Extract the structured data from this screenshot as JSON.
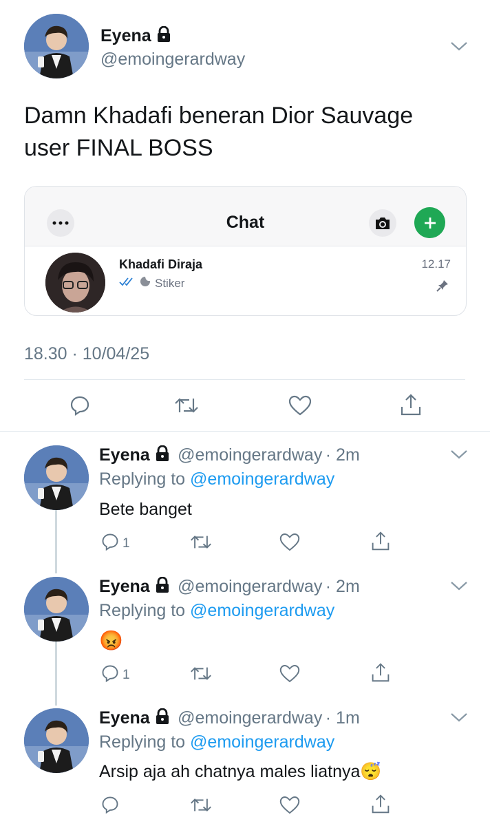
{
  "tweet": {
    "name": "Eyena",
    "handle": "@emoingerardway",
    "text": "Damn Khadafi beneran Dior Sauvage user FINAL BOSS",
    "timestamp": "18.30 · 10/04/25",
    "embed": {
      "header_title": "Chat",
      "contact_name": "Khadafi Diraja",
      "preview": "Stiker",
      "time": "12.17",
      "icons": [
        "more-icon",
        "camera-icon",
        "plus-icon",
        "double-check-icon",
        "sticker-icon",
        "pin-icon"
      ]
    }
  },
  "replies": [
    {
      "name": "Eyena",
      "handle": "@emoingerardway",
      "time": "· 2m",
      "replying_prefix": "Replying to",
      "replying_handle": "@emoingerardway",
      "text": "Bete banget",
      "reply_count": "1"
    },
    {
      "name": "Eyena",
      "handle": "@emoingerardway",
      "time": "· 2m",
      "replying_prefix": "Replying to",
      "replying_handle": "@emoingerardway",
      "text": "😡",
      "reply_count": "1"
    },
    {
      "name": "Eyena",
      "handle": "@emoingerardway",
      "time": "· 1m",
      "replying_prefix": "Replying to",
      "replying_handle": "@emoingerardway",
      "text": "Arsip aja ah chatnya males liatnya😴",
      "reply_count": ""
    }
  ],
  "colors": {
    "link": "#1d9bf0",
    "muted": "#657786",
    "whatsapp_green": "#1fa855"
  }
}
